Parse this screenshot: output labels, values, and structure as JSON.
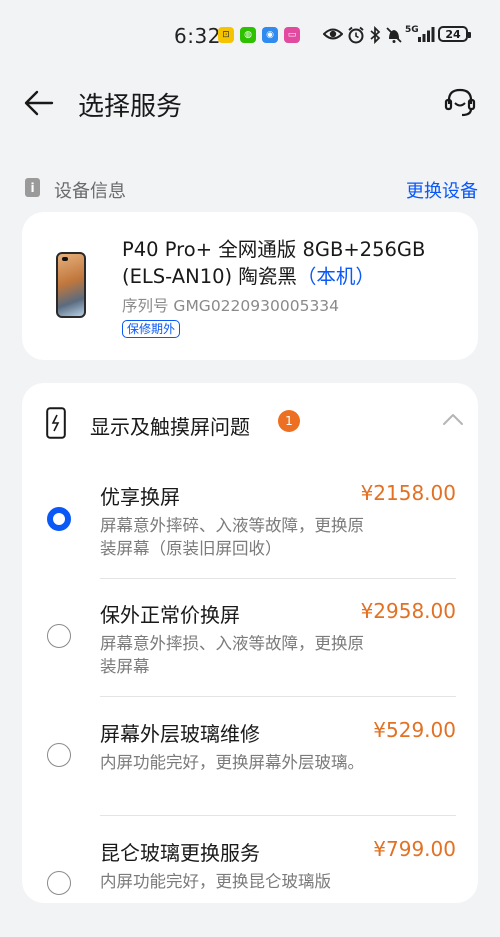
{
  "status_bar": {
    "time": "6:32",
    "network": "5G",
    "battery": "24"
  },
  "header": {
    "title": "选择服务"
  },
  "device_section": {
    "title": "设备信息",
    "change_link": "更换设备"
  },
  "device": {
    "name": "P40 Pro+ 全网通版 8GB+256GB (ELS-AN10) 陶瓷黑",
    "local_tag": "（本机）",
    "serial": "序列号 GMG0220930005334",
    "warranty": "保修期外"
  },
  "category": {
    "title": "显示及触摸屏问题",
    "badge": "1",
    "expanded": true
  },
  "options": [
    {
      "name": "优享换屏",
      "price": "¥2158.00",
      "desc": "屏幕意外摔碎、入液等故障，更换原装屏幕（原装旧屏回收）",
      "selected": true
    },
    {
      "name": "保外正常价换屏",
      "price": "¥2958.00",
      "desc": "屏幕意外摔损、入液等故障，更换原装屏幕",
      "selected": false
    },
    {
      "name": "屏幕外层玻璃维修",
      "price": "¥529.00",
      "desc": "内屏功能完好，更换屏幕外层玻璃。",
      "selected": false
    },
    {
      "name": "昆仑玻璃更换服务",
      "price": "¥799.00",
      "desc": "内屏功能完好，更换昆仑玻璃版",
      "selected": false
    }
  ],
  "colors": {
    "accent": "#0a59f7",
    "price": "#e27124",
    "badge": "#ed6f21",
    "background": "#f1f3f5"
  }
}
